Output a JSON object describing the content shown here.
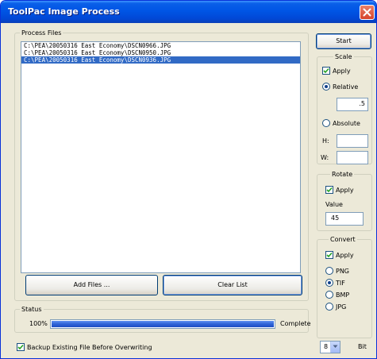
{
  "window": {
    "title": "ToolPac Image Process"
  },
  "process_files": {
    "legend": "Process Files",
    "files": [
      "C:\\PEA\\20050316 East Economy\\DSCN0966.JPG",
      "C:\\PEA\\20050316 East Economy\\DSCN0950.JPG",
      "C:\\PEA\\20050316 East Economy\\DSCN0936.JPG"
    ],
    "selected_index": 2,
    "add_files_label": "Add Files ...",
    "clear_list_label": "Clear List"
  },
  "status": {
    "legend": "Status",
    "percent_text": "100%",
    "progress_value": 100,
    "state_text": "Complete"
  },
  "backup_label": "Backup Existing File Before Overwriting",
  "start_label": "Start",
  "scale": {
    "legend": "Scale",
    "apply_label": "Apply",
    "relative_label": "Relative",
    "relative_value": ".5",
    "absolute_label": "Absolute",
    "h_label": "H:",
    "h_value": "",
    "w_label": "W:",
    "w_value": ""
  },
  "rotate": {
    "legend": "Rotate",
    "apply_label": "Apply",
    "value_label": "Value",
    "value": "45"
  },
  "convert": {
    "legend": "Convert",
    "apply_label": "Apply",
    "formats": [
      "PNG",
      "TIF",
      "BMP",
      "JPG"
    ],
    "selected_format": "TIF",
    "bit_value": "8",
    "bit_label": "Bit"
  },
  "colors": {
    "title_bar": "#0055e5",
    "selection": "#316ac5",
    "progress": "#2f63d6",
    "face": "#ece9d8"
  },
  "icons": {
    "close": "close-icon",
    "check": "check-icon",
    "dropdown": "chevron-down-icon"
  }
}
